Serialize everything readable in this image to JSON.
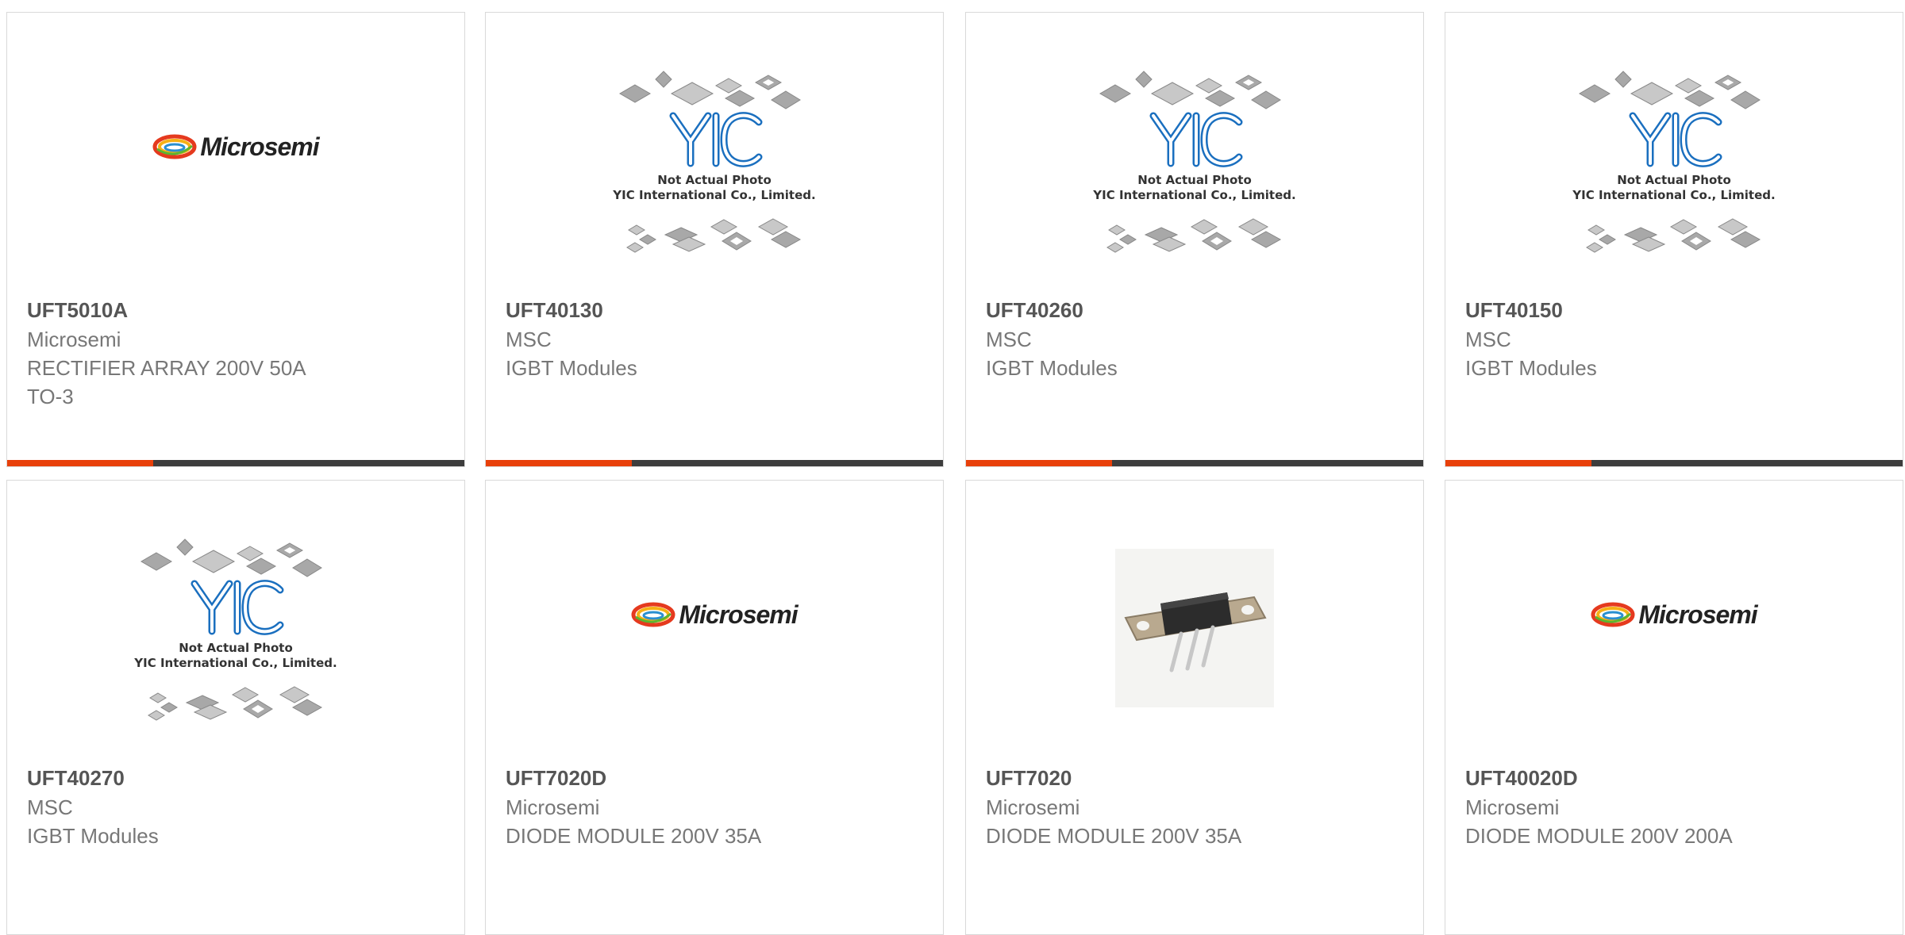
{
  "products": [
    {
      "part_number": "UFT5010A",
      "lines": [
        "Microsemi",
        "RECTIFIER ARRAY 200V 50A",
        "TO-3"
      ],
      "image": "microsemi-logo",
      "show_accent": true
    },
    {
      "part_number": "UFT40130",
      "lines": [
        "MSC",
        "IGBT Modules"
      ],
      "image": "yic-placeholder",
      "show_accent": true
    },
    {
      "part_number": "UFT40260",
      "lines": [
        "MSC",
        "IGBT Modules"
      ],
      "image": "yic-placeholder",
      "show_accent": true
    },
    {
      "part_number": "UFT40150",
      "lines": [
        "MSC",
        "IGBT Modules"
      ],
      "image": "yic-placeholder",
      "show_accent": true
    },
    {
      "part_number": "UFT40270",
      "lines": [
        "MSC",
        "IGBT Modules"
      ],
      "image": "yic-placeholder",
      "show_accent": false
    },
    {
      "part_number": "UFT7020D",
      "lines": [
        "Microsemi",
        "DIODE MODULE 200V 35A"
      ],
      "image": "microsemi-logo",
      "show_accent": false
    },
    {
      "part_number": "UFT7020",
      "lines": [
        "Microsemi",
        "DIODE MODULE 200V 35A"
      ],
      "image": "device-photo",
      "show_accent": false
    },
    {
      "part_number": "UFT40020D",
      "lines": [
        "Microsemi",
        "DIODE MODULE 200V 200A"
      ],
      "image": "microsemi-logo",
      "show_accent": false
    }
  ],
  "logo": {
    "wordmark": "Microsemi"
  },
  "yic": {
    "caption_line1": "Not Actual Photo",
    "caption_line2": "YIC International Co., Limited."
  },
  "colors": {
    "accent_orange": "#e8400a",
    "accent_dark": "#3d3d3d",
    "yic_blue": "#1a6fbf"
  }
}
